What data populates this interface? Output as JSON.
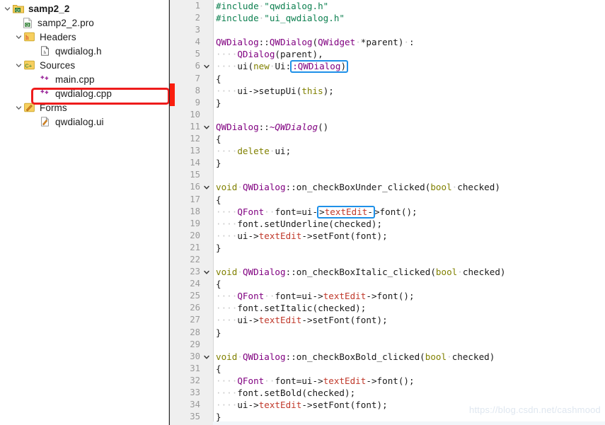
{
  "sidebar": {
    "items": [
      {
        "label": "samp2_2",
        "indent": 0,
        "arrow": "down",
        "icon": "qt-project-folder-icon",
        "bold": true,
        "selected": false
      },
      {
        "label": "samp2_2.pro",
        "indent": 1,
        "arrow": "none",
        "icon": "qt-pro-file-icon",
        "bold": false,
        "selected": false
      },
      {
        "label": "Headers",
        "indent": 1,
        "arrow": "down",
        "icon": "headers-folder-icon",
        "bold": false,
        "selected": false
      },
      {
        "label": "qwdialog.h",
        "indent": 2,
        "arrow": "none",
        "icon": "header-file-icon",
        "bold": false,
        "selected": false
      },
      {
        "label": "Sources",
        "indent": 1,
        "arrow": "down",
        "icon": "sources-folder-icon",
        "bold": false,
        "selected": false
      },
      {
        "label": "main.cpp",
        "indent": 2,
        "arrow": "none",
        "icon": "cpp-file-icon",
        "bold": false,
        "selected": false
      },
      {
        "label": "qwdialog.cpp",
        "indent": 2,
        "arrow": "none",
        "icon": "cpp-file-icon",
        "bold": false,
        "selected": true
      },
      {
        "label": "Forms",
        "indent": 1,
        "arrow": "down",
        "icon": "forms-folder-icon",
        "bold": false,
        "selected": false
      },
      {
        "label": "qwdialog.ui",
        "indent": 2,
        "arrow": "none",
        "icon": "ui-file-icon",
        "bold": false,
        "selected": false
      }
    ],
    "annotation_color": "#ee1c1c",
    "selection_color": "#dcdcdc"
  },
  "editor": {
    "highlight_box_color": "#1e90e8",
    "modified_marker_color": "#fa1e0e",
    "gutter_bg": "#efefef",
    "file": "qwdialog.cpp",
    "lines": [
      {
        "n": 1,
        "fold": false,
        "text": "#include \"qwdialog.h\""
      },
      {
        "n": 2,
        "fold": false,
        "text": "#include \"ui_qwdialog.h\""
      },
      {
        "n": 3,
        "fold": false,
        "text": ""
      },
      {
        "n": 4,
        "fold": false,
        "text": "QWDialog::QWDialog(QWidget *parent) :"
      },
      {
        "n": 5,
        "fold": false,
        "text": "    QDialog(parent),"
      },
      {
        "n": 6,
        "fold": true,
        "text": "    ui(new Ui::QWDialog)"
      },
      {
        "n": 7,
        "fold": false,
        "text": "{"
      },
      {
        "n": 8,
        "fold": false,
        "text": "    ui->setupUi(this);"
      },
      {
        "n": 9,
        "fold": false,
        "text": "}"
      },
      {
        "n": 10,
        "fold": false,
        "text": ""
      },
      {
        "n": 11,
        "fold": true,
        "text": "QWDialog::~QWDialog()"
      },
      {
        "n": 12,
        "fold": false,
        "text": "{"
      },
      {
        "n": 13,
        "fold": false,
        "text": "    delete ui;"
      },
      {
        "n": 14,
        "fold": false,
        "text": "}"
      },
      {
        "n": 15,
        "fold": false,
        "text": ""
      },
      {
        "n": 16,
        "fold": true,
        "text": "void QWDialog::on_checkBoxUnder_clicked(bool checked)"
      },
      {
        "n": 17,
        "fold": false,
        "text": "{"
      },
      {
        "n": 18,
        "fold": false,
        "text": "    QFont  font=ui->textEdit->font();"
      },
      {
        "n": 19,
        "fold": false,
        "text": "    font.setUnderline(checked);"
      },
      {
        "n": 20,
        "fold": false,
        "text": "    ui->textEdit->setFont(font);"
      },
      {
        "n": 21,
        "fold": false,
        "text": "}"
      },
      {
        "n": 22,
        "fold": false,
        "text": ""
      },
      {
        "n": 23,
        "fold": true,
        "text": "void QWDialog::on_checkBoxItalic_clicked(bool checked)"
      },
      {
        "n": 24,
        "fold": false,
        "text": "{"
      },
      {
        "n": 25,
        "fold": false,
        "text": "    QFont  font=ui->textEdit->font();"
      },
      {
        "n": 26,
        "fold": false,
        "text": "    font.setItalic(checked);"
      },
      {
        "n": 27,
        "fold": false,
        "text": "    ui->textEdit->setFont(font);"
      },
      {
        "n": 28,
        "fold": false,
        "text": "}"
      },
      {
        "n": 29,
        "fold": false,
        "text": ""
      },
      {
        "n": 30,
        "fold": true,
        "text": "void QWDialog::on_checkBoxBold_clicked(bool checked)"
      },
      {
        "n": 31,
        "fold": false,
        "text": "{"
      },
      {
        "n": 32,
        "fold": false,
        "text": "    QFont  font=ui->textEdit->font();"
      },
      {
        "n": 33,
        "fold": false,
        "text": "    font.setBold(checked);"
      },
      {
        "n": 34,
        "fold": false,
        "text": "    ui->textEdit->setFont(font);"
      },
      {
        "n": 35,
        "fold": false,
        "text": "}"
      }
    ],
    "highlighted_tokens": [
      {
        "line": 6,
        "token": "QWDialog)"
      },
      {
        "line": 18,
        "token": "textEdit"
      }
    ]
  },
  "watermark": {
    "text": "https://blog.csdn.net/cashmood"
  }
}
